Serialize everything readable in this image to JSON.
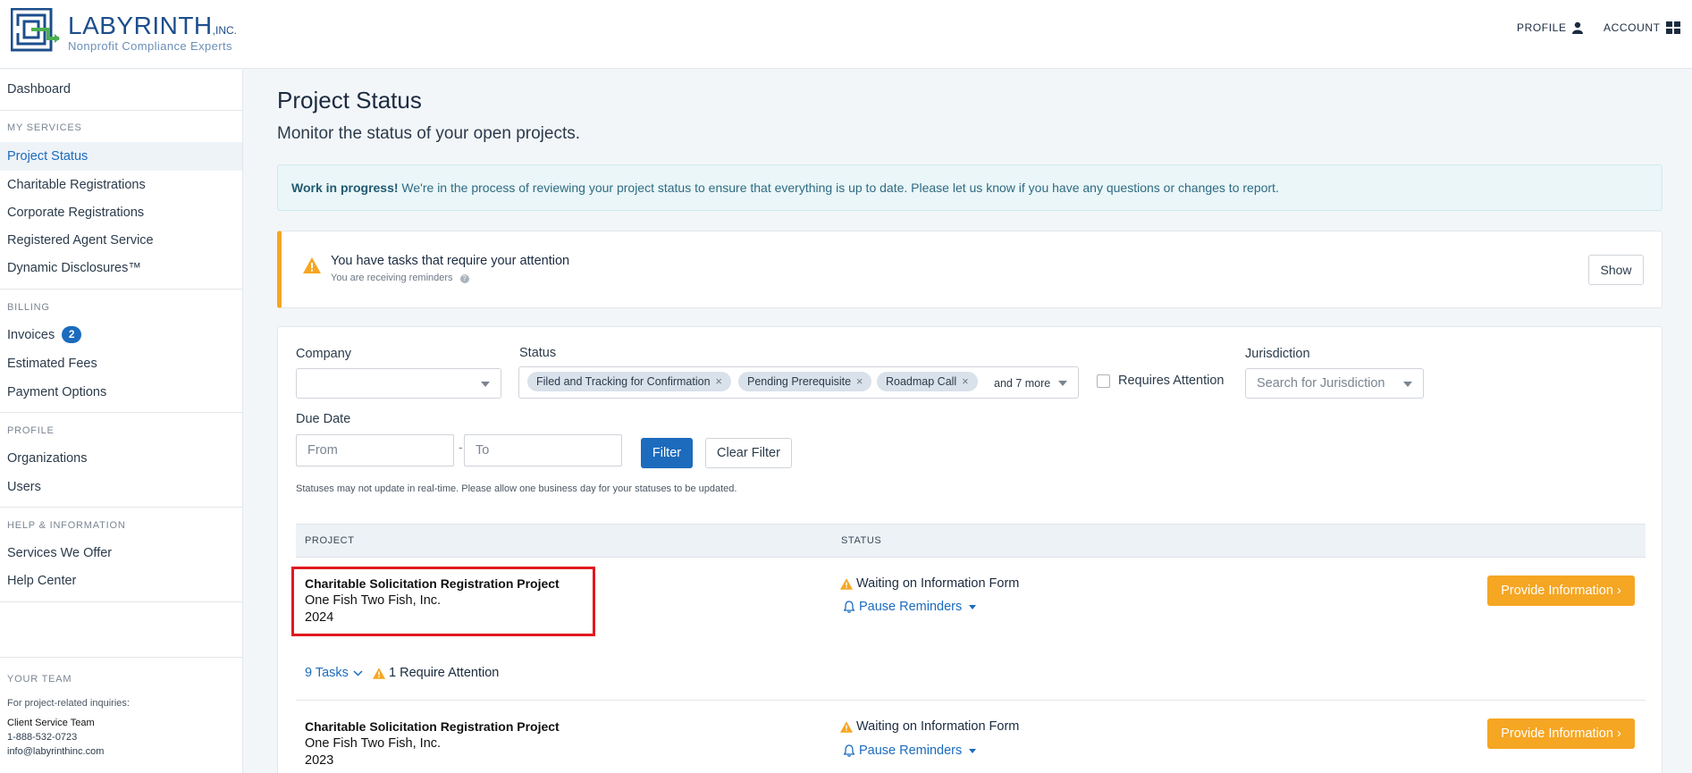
{
  "header": {
    "logo_name": "LABYRINTH",
    "logo_inc": ",INC.",
    "logo_tagline": "Nonprofit Compliance Experts",
    "profile_label": "PROFILE",
    "account_label": "ACCOUNT"
  },
  "sidebar": {
    "dashboard": "Dashboard",
    "my_services_head": "MY SERVICES",
    "services": [
      "Project Status",
      "Charitable Registrations",
      "Corporate Registrations",
      "Registered Agent Service",
      "Dynamic Disclosures™"
    ],
    "billing_head": "BILLING",
    "invoices": "Invoices",
    "invoices_badge": "2",
    "estimated_fees": "Estimated Fees",
    "payment_options": "Payment Options",
    "profile_head": "PROFILE",
    "organizations": "Organizations",
    "users": "Users",
    "help_head": "HELP & INFORMATION",
    "services_we_offer": "Services We Offer",
    "help_center": "Help Center",
    "team_head": "YOUR TEAM",
    "team_note": "For project-related inquiries:",
    "team_name": "Client Service Team",
    "team_phone": "1-888-532-0723",
    "team_email": "info@labyrinthinc.com"
  },
  "main": {
    "title": "Project Status",
    "subtitle": "Monitor the status of your open projects.",
    "info_bold": "Work in progress!",
    "info_text": " We're in the process of reviewing your project status to ensure that everything is up to date. Please let us know if you have any questions or changes to report.",
    "alert_title": "You have tasks that require your attention",
    "alert_sub": "You are receiving reminders",
    "show_label": "Show"
  },
  "filters": {
    "company_label": "Company",
    "company_value": "",
    "status_label": "Status",
    "status_chips": [
      "Filed and Tracking for Confirmation",
      "Pending Prerequisite",
      "Roadmap Call"
    ],
    "status_more": "and 7 more",
    "requires_attention_label": "Requires Attention",
    "jurisdiction_label": "Jurisdiction",
    "jurisdiction_placeholder": "Search for Jurisdiction",
    "due_date_label": "Due Date",
    "from_placeholder": "From",
    "to_placeholder": "To",
    "date_separator": "-",
    "filter_button": "Filter",
    "clear_button": "Clear Filter",
    "note": "Statuses may not update in real-time. Please allow one business day for your statuses to be updated."
  },
  "table": {
    "col_project": "PROJECT",
    "col_status": "STATUS",
    "rows": [
      {
        "title": "Charitable Solicitation Registration Project",
        "org": "One Fish Two Fish, Inc.",
        "year": "2024",
        "status": "Waiting on Information Form",
        "pause": "Pause Reminders",
        "action": "Provide Information ›",
        "tasks": "9 Tasks",
        "attention": "1 Require Attention"
      },
      {
        "title": "Charitable Solicitation Registration Project",
        "org": "One Fish Two Fish, Inc.",
        "year": "2023",
        "status": "Waiting on Information Form",
        "pause": "Pause Reminders",
        "action": "Provide Information ›"
      }
    ]
  },
  "colors": {
    "brand_blue": "#1c6bbd",
    "warning_orange": "#f5a623",
    "highlight_red": "#e0191f"
  }
}
